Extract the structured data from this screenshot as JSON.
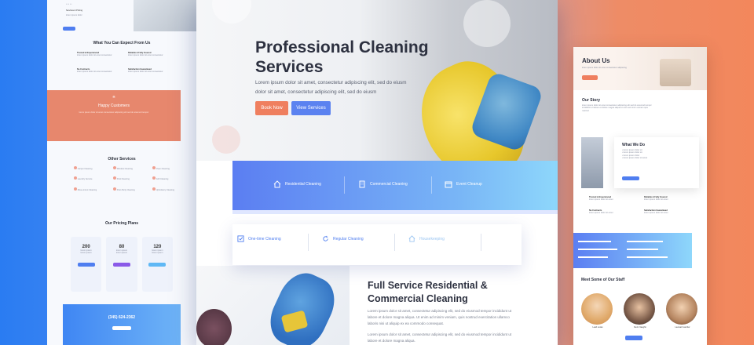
{
  "hero": {
    "title": "Professional Cleaning Services",
    "subtitle": "Lorem ipsum dolor sit amet, consectetur adipiscing elit, sed do eiusm dolor sit amet, consectetur adipiscing elit, sed do eiusm",
    "btn_primary": "Book Now",
    "btn_secondary": "View Services"
  },
  "services_bar": [
    "Residential Cleaning",
    "Commercial Cleaning",
    "Event Cleanup"
  ],
  "services_row2": [
    "One-time Cleaning",
    "Regular Cleaning",
    "Housekeeping"
  ],
  "full_service": {
    "title": "Full Service Residential & Commercial Cleaning",
    "p1": "Lorem ipsum dolor sit amet, consectetur adipiscing elit, sed do eiusmod tempor incididunt ut labore et dolore magna aliqua. Ut enim ad minim veniam, quis nostrud exercitation ullamco laboris nisi ut aliquip ex ea commodo consequat.",
    "p2": "Lorem ipsum dolor sit amet, consectetur adipiscing elit, sed do eiusmod tempor incididunt ut labore et dolore magna aliqua."
  },
  "left": {
    "services_pricing": "Services & Pricing",
    "expect_title": "What You Can Expect From Us",
    "expect": [
      "Trusted & Experienced",
      "Reliable & Fully Insured",
      "No Contracts",
      "Satisfaction Guaranteed"
    ],
    "happy": "Happy Customers",
    "other_title": "Other Services",
    "other": [
      "Carpet Cleaning",
      "Window Cleaning",
      "Oven Cleaning",
      "Laundry Service",
      "Pool Cleaning",
      "Grill Cleaning",
      "Move-in/out Cleaning",
      "Post-Party Cleaning",
      "Upholstery Cleaning"
    ],
    "pricing_title": "Our Pricing Plans",
    "prices": [
      "200",
      "80",
      "120"
    ],
    "phone": "(345) 624-2362"
  },
  "right": {
    "about": "About Us",
    "story": "Our Story",
    "what_we_do": "What We Do",
    "trusted": "Trusted & Experienced",
    "reliable": "Reliable & Fully Insured",
    "no_contracts": "No Contracts",
    "satisfaction": "Satisfaction Guaranteed",
    "staff_title": "Meet Some of Our Staff",
    "staff": [
      "Leah Lewis",
      "Kevin Vaughn",
      "Leonard Lamber"
    ]
  }
}
